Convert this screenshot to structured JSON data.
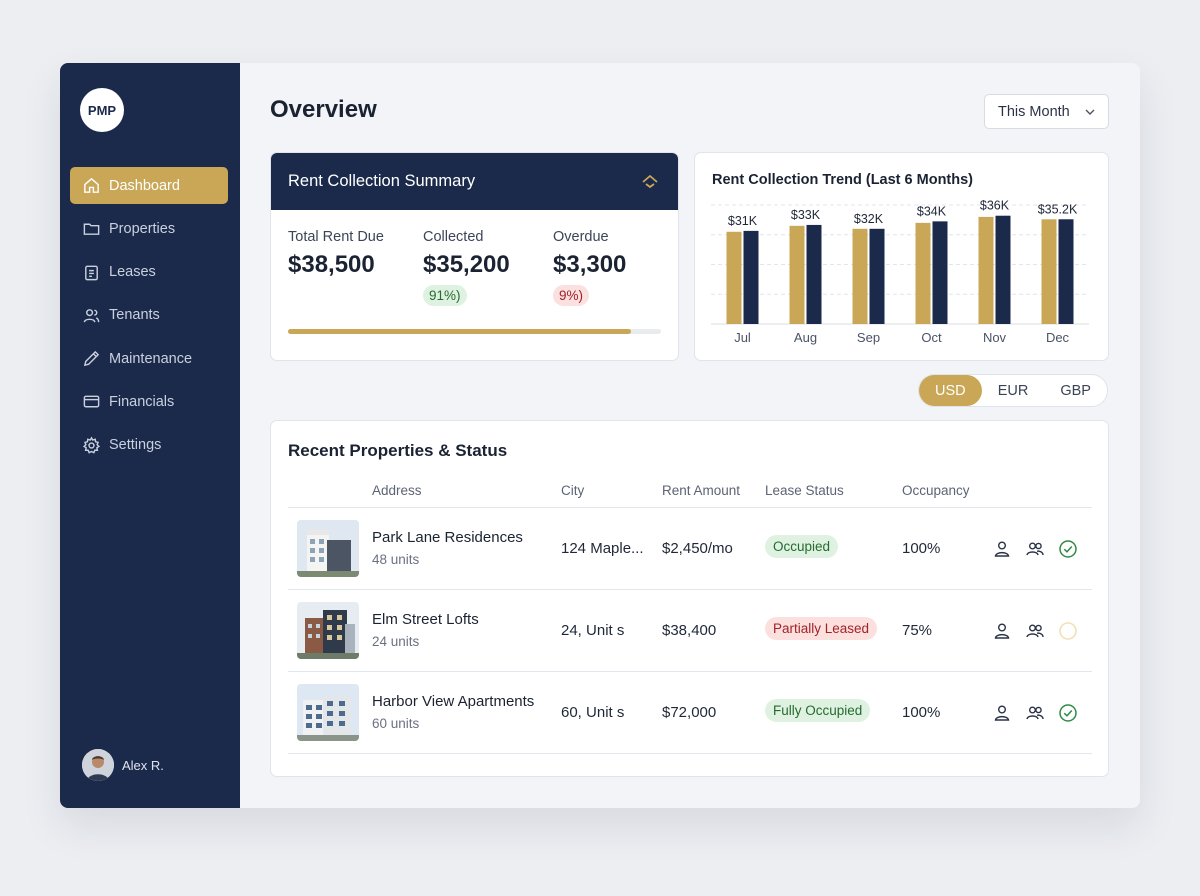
{
  "app": {
    "logo": "PMP",
    "page_title": "Overview"
  },
  "sidebar": {
    "items": [
      {
        "label": "Dashboard",
        "icon": "home-icon",
        "active": true
      },
      {
        "label": "Properties",
        "icon": "folder-icon"
      },
      {
        "label": "Leases",
        "icon": "clipboard-icon"
      },
      {
        "label": "Tenants",
        "icon": "users-icon"
      },
      {
        "label": "Maintenance",
        "icon": "pencil-icon"
      },
      {
        "label": "Financials",
        "icon": "card-icon"
      },
      {
        "label": "Settings",
        "icon": "gear-icon"
      }
    ],
    "user": {
      "name": "Alex R."
    }
  },
  "filter": {
    "period": "This Month"
  },
  "summary": {
    "title": "Rent Collection Summary",
    "total_label": "Total Rent Due",
    "total_value": "$38,500",
    "collected_label": "Collected",
    "collected_value": "$35,200",
    "collected_pct": "91%)",
    "overdue_label": "Overdue",
    "overdue_value": "$3,300",
    "overdue_pct": "9%)",
    "progress": 0.92
  },
  "trend": {
    "title": "Rent Collection Trend (Last 6 Months)"
  },
  "chart_data": {
    "type": "bar",
    "title": "Rent Collection Trend (Last 6 Months)",
    "categories": [
      "Jul",
      "Aug",
      "Sep",
      "Oct",
      "Nov",
      "Dec"
    ],
    "data_labels": [
      "$31K",
      "$33K",
      "$32K",
      "$34K",
      "$36K",
      "$35.2K"
    ],
    "series": [
      {
        "values": [
          31,
          33,
          32,
          34,
          36,
          35.2
        ],
        "color": "#c9a757"
      },
      {
        "values": [
          31.3,
          33.3,
          32,
          34.5,
          36.4,
          35.2
        ],
        "color": "#1b2a4b"
      }
    ],
    "ylim": [
      0,
      40
    ],
    "grid": true
  },
  "currency": {
    "options": [
      "USD",
      "EUR",
      "GBP"
    ],
    "selected": "USD"
  },
  "properties": {
    "title": "Recent Properties & Status",
    "columns": [
      "Address",
      "City",
      "Rent Amount",
      "Lease Status",
      "Occupancy"
    ],
    "rows": [
      {
        "name": "Park Lane Residences",
        "units": "48 units",
        "city": "124 Maple...",
        "rent": "$2,450/mo",
        "status": "Occupied",
        "status_tone": "green",
        "occupancy": "100%",
        "check": "ok"
      },
      {
        "name": "Elm Street Lofts",
        "units": "24 units",
        "city": "24, Unit s",
        "rent": "$38,400",
        "status": "Partially Leased",
        "status_tone": "red",
        "occupancy": "75%",
        "check": "pending"
      },
      {
        "name": "Harbor View Apartments",
        "units": "60 units",
        "city": "60, Unit s",
        "rent": "$72,000",
        "status": "Fully Occupied",
        "status_tone": "green",
        "occupancy": "100%",
        "check": "ok"
      }
    ]
  },
  "colors": {
    "navy": "#1b2a4b",
    "gold": "#c9a757",
    "green": "#2f8a43"
  }
}
